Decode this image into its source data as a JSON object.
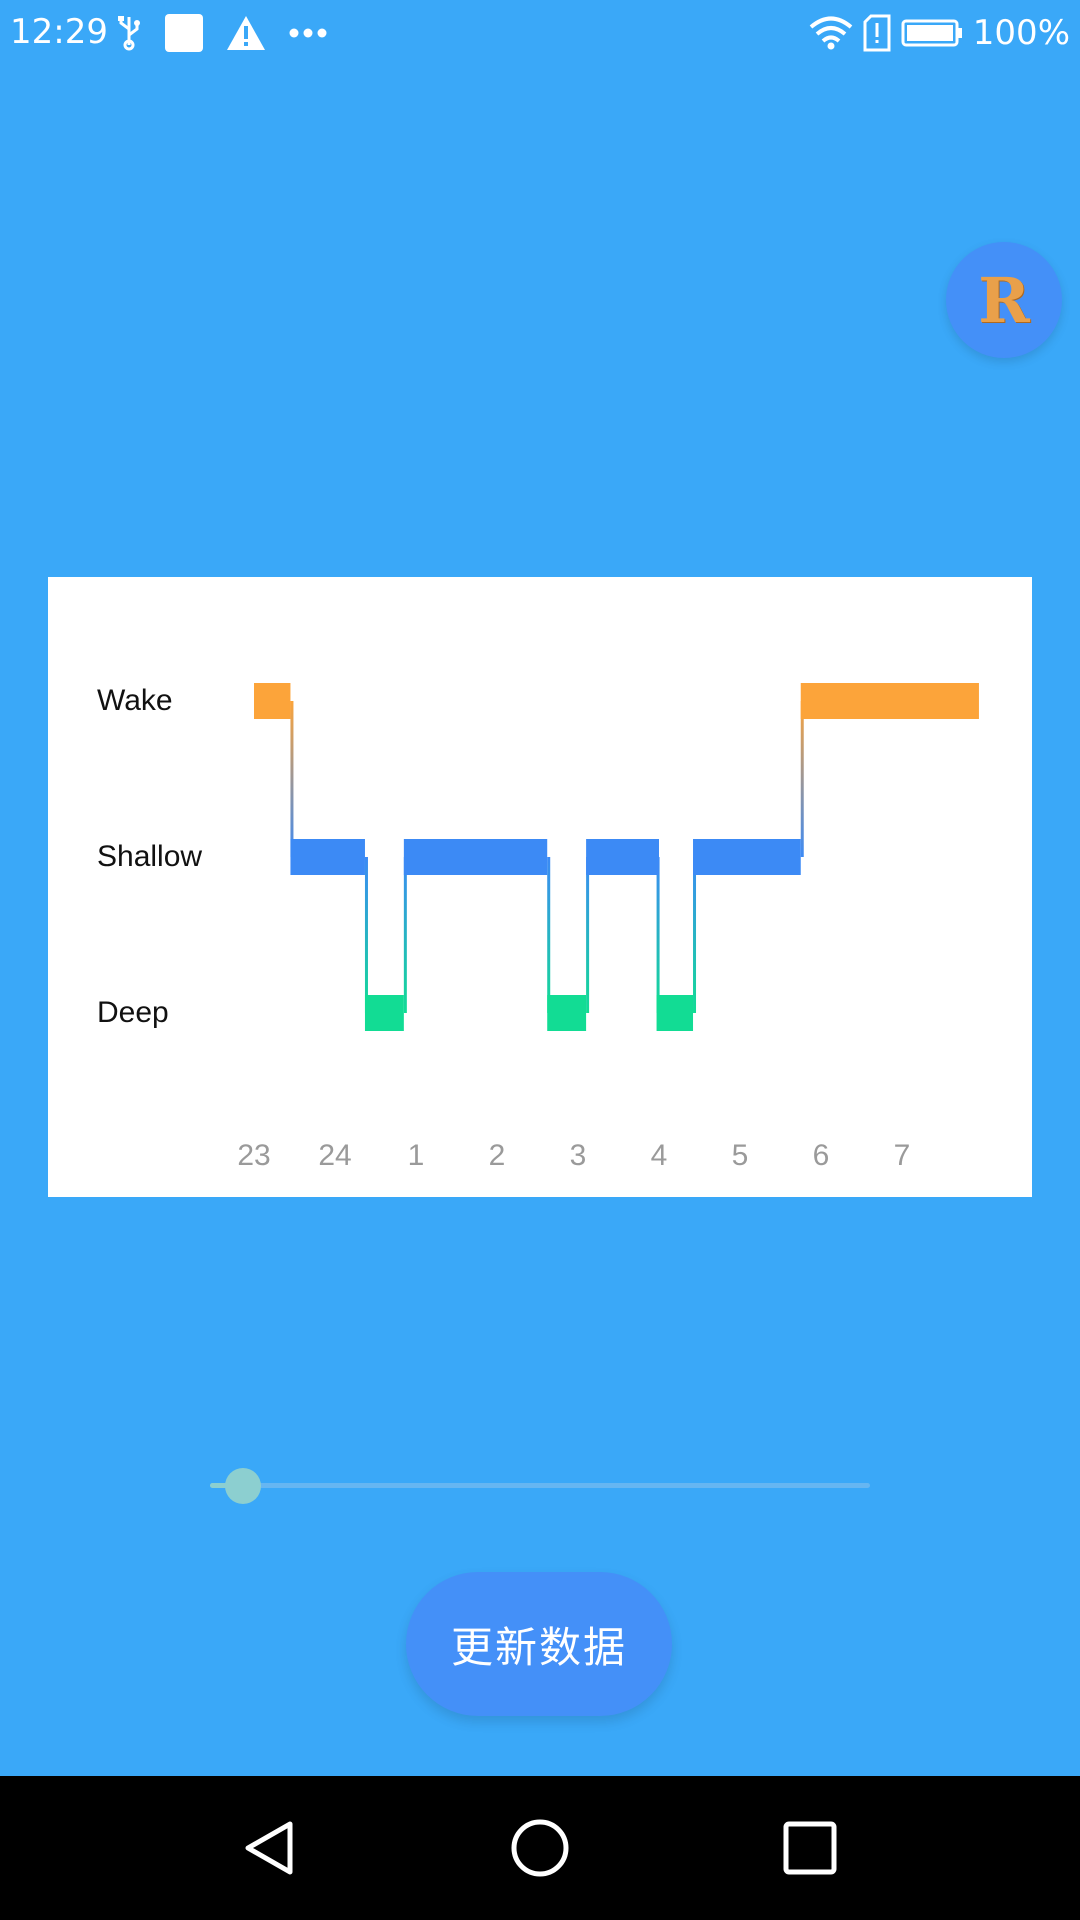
{
  "status_bar": {
    "time": "12:29",
    "battery_percent": "100%",
    "icons_left": [
      "usb-icon",
      "notification-square-icon",
      "warning-icon",
      "more-dots-icon"
    ],
    "icons_right": [
      "wifi-icon",
      "sim-alert-icon",
      "battery-icon"
    ]
  },
  "avatar": {
    "letter": "R",
    "color": "#e9a04a",
    "background": "#4490f8"
  },
  "chart_data": {
    "type": "step",
    "y_categories": [
      "Wake",
      "Shallow",
      "Deep"
    ],
    "x_ticks": [
      "23",
      "24",
      "1",
      "2",
      "3",
      "4",
      "5",
      "6",
      "7"
    ],
    "segments": [
      {
        "stage": "Wake",
        "start": 23.0,
        "end": 23.45
      },
      {
        "stage": "Shallow",
        "start": 23.45,
        "end": 24.37
      },
      {
        "stage": "Deep",
        "start": 24.37,
        "end": 24.85
      },
      {
        "stage": "Shallow",
        "start": 24.85,
        "end": 26.62
      },
      {
        "stage": "Deep",
        "start": 26.62,
        "end": 27.1
      },
      {
        "stage": "Shallow",
        "start": 27.1,
        "end": 28.0
      },
      {
        "stage": "Deep",
        "start": 27.97,
        "end": 28.42
      },
      {
        "stage": "Shallow",
        "start": 28.42,
        "end": 29.75
      },
      {
        "stage": "Wake",
        "start": 29.75,
        "end": 31.95
      }
    ],
    "colors": {
      "Wake": "#fca43a",
      "Shallow": "#3c8af5",
      "Deep": "#12dc94"
    },
    "grid": false
  },
  "slider": {
    "value": 0.05
  },
  "actions": {
    "update_label": "更新数据"
  },
  "colors": {
    "background": "#3aa8f8",
    "button": "#4490f8"
  }
}
